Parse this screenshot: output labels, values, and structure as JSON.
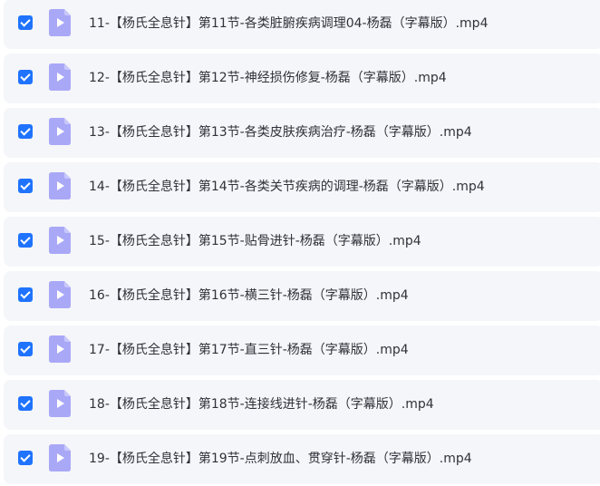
{
  "file_list": {
    "rows": [
      {
        "checked": true,
        "icon": "video-file-icon",
        "name": "11-【杨氏全息针】第11节-各类脏腑疾病调理04-杨磊（字幕版）.mp4"
      },
      {
        "checked": true,
        "icon": "video-file-icon",
        "name": "12-【杨氏全息针】第12节-神经损伤修复-杨磊（字幕版）.mp4"
      },
      {
        "checked": true,
        "icon": "video-file-icon",
        "name": "13-【杨氏全息针】第13节-各类皮肤疾病治疗-杨磊（字幕版）.mp4"
      },
      {
        "checked": true,
        "icon": "video-file-icon",
        "name": "14-【杨氏全息针】第14节-各类关节疾病的调理-杨磊（字幕版）.mp4"
      },
      {
        "checked": true,
        "icon": "video-file-icon",
        "name": "15-【杨氏全息针】第15节-贴骨进针-杨磊（字幕版）.mp4"
      },
      {
        "checked": true,
        "icon": "video-file-icon",
        "name": "16-【杨氏全息针】第16节-横三针-杨磊（字幕版）.mp4"
      },
      {
        "checked": true,
        "icon": "video-file-icon",
        "name": "17-【杨氏全息针】第17节-直三针-杨磊（字幕版）.mp4"
      },
      {
        "checked": true,
        "icon": "video-file-icon",
        "name": "18-【杨氏全息针】第18节-连接线进针-杨磊（字幕版）.mp4"
      },
      {
        "checked": true,
        "icon": "video-file-icon",
        "name": "19-【杨氏全息针】第19节-点刺放血、贯穿针-杨磊（字幕版）.mp4"
      }
    ]
  },
  "colors": {
    "row_background": "#f5f6f9",
    "checkbox": "#1f73ff",
    "icon_fill": "#a9a8f7",
    "icon_fold": "#c9c8fb",
    "text": "#2f3239"
  }
}
